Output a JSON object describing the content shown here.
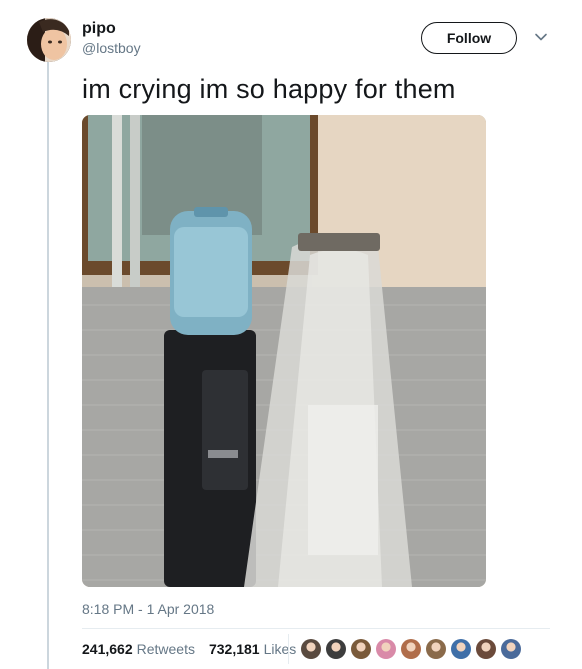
{
  "tweet": {
    "display_name": "pipo",
    "handle": "@lostboy",
    "follow_label": "Follow",
    "text": "im crying im so happy for them",
    "timestamp": "8:18 PM - 1 Apr 2018"
  },
  "stats": {
    "retweets_count": "241,662",
    "retweets_label": "Retweets",
    "likes_count": "732,181",
    "likes_label": "Likes"
  },
  "likers": [
    {
      "color": "#5a4a3f"
    },
    {
      "color": "#3d3d3d"
    },
    {
      "color": "#7a5a3a"
    },
    {
      "color": "#d98aa8"
    },
    {
      "color": "#b06d4a"
    },
    {
      "color": "#8a6a4a"
    },
    {
      "color": "#3f6fa8"
    },
    {
      "color": "#6b4a3a"
    },
    {
      "color": "#4a6a9a"
    }
  ],
  "colors": {
    "text": "#14171a",
    "secondary": "#657786",
    "divider": "#e6ecf0"
  }
}
